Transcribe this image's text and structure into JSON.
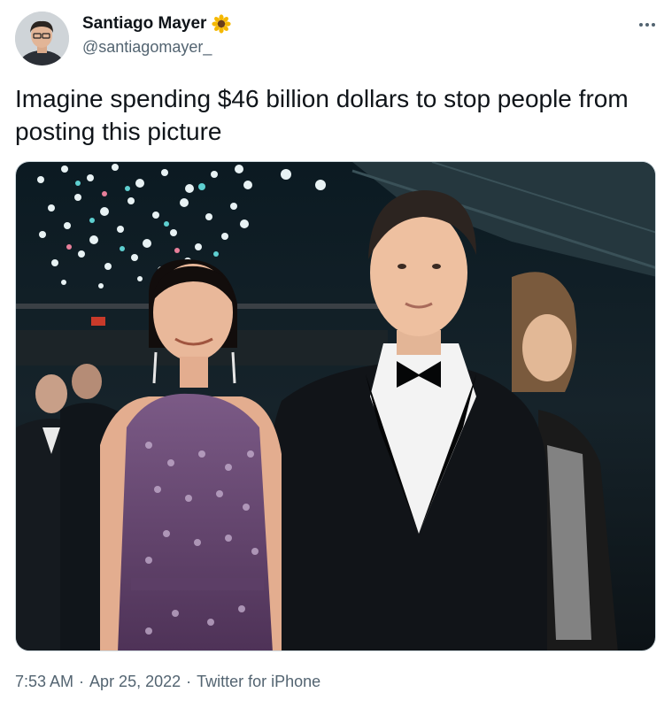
{
  "author": {
    "display_name": "Santiago Mayer",
    "handle": "@santiagomayer_",
    "badge_icon": "sunflower-icon"
  },
  "tweet": {
    "text": "Imagine spending $46 billion dollars to stop people from posting this picture"
  },
  "media": {
    "type": "photo",
    "icon": "photo-image"
  },
  "meta": {
    "time": "7:53 AM",
    "separator": "·",
    "date": "Apr 25, 2022",
    "source": "Twitter for iPhone"
  },
  "colors": {
    "text_primary": "#0f1419",
    "text_secondary": "#536471",
    "border": "#cfd9de"
  }
}
